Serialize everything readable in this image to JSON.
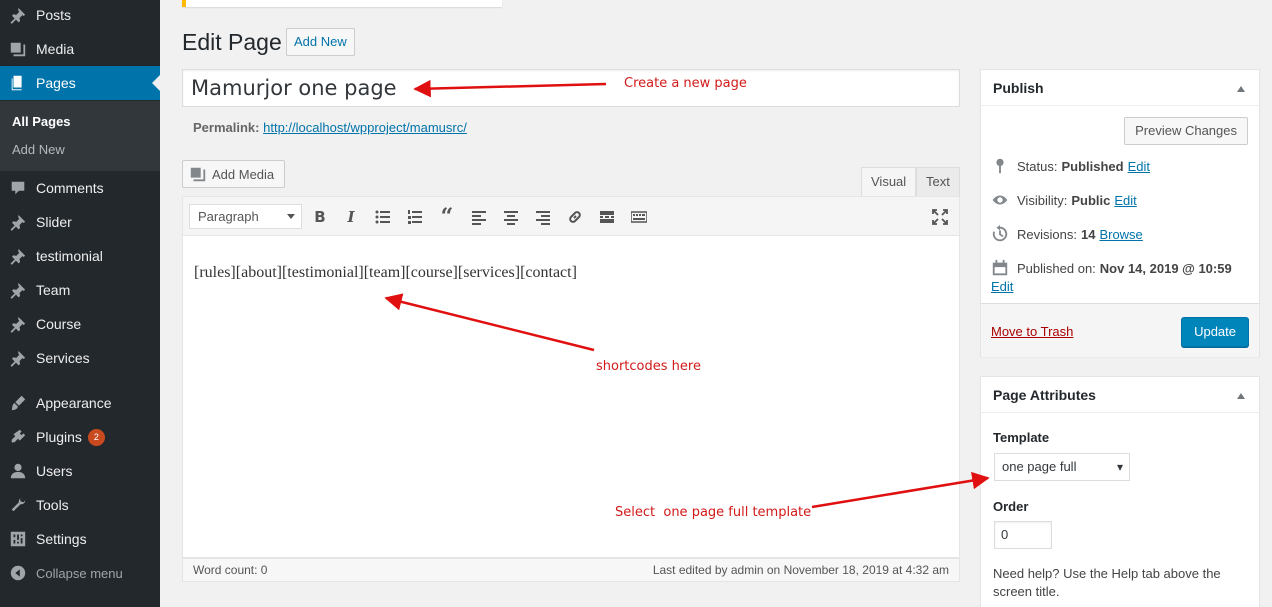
{
  "sidebar": {
    "items": [
      {
        "label": "Posts",
        "icon": "pin-icon"
      },
      {
        "label": "Media",
        "icon": "media-icon"
      },
      {
        "label": "Pages",
        "icon": "pages-icon",
        "active": true
      },
      {
        "label": "Comments",
        "icon": "comment-icon"
      },
      {
        "label": "Slider",
        "icon": "pin-icon"
      },
      {
        "label": "testimonial",
        "icon": "pin-icon"
      },
      {
        "label": "Team",
        "icon": "pin-icon"
      },
      {
        "label": "Course",
        "icon": "pin-icon"
      },
      {
        "label": "Services",
        "icon": "pin-icon"
      },
      {
        "label": "Appearance",
        "icon": "brush-icon"
      },
      {
        "label": "Plugins",
        "icon": "plugin-icon",
        "badge": "2"
      },
      {
        "label": "Users",
        "icon": "user-icon"
      },
      {
        "label": "Tools",
        "icon": "wrench-icon"
      },
      {
        "label": "Settings",
        "icon": "settings-icon"
      }
    ],
    "submenu": [
      "All Pages",
      "Add New"
    ],
    "collapse_label": "Collapse menu"
  },
  "page": {
    "heading": "Edit Page",
    "add_new_label": "Add New",
    "title_value": "Mamurjor one page",
    "permalink_label": "Permalink:",
    "permalink_url": "http://localhost/wpproject/mamusrc/"
  },
  "editor": {
    "add_media_label": "Add Media",
    "tab_visual": "Visual",
    "tab_text": "Text",
    "format_value": "Paragraph",
    "content": "[rules][about][testimonial][team][course][services][contact]",
    "word_count": "Word count: 0",
    "last_edited": "Last edited by admin on November 18, 2019 at 4:32 am"
  },
  "publish": {
    "title": "Publish",
    "preview_label": "Preview Changes",
    "status_label": "Status:",
    "status_value": "Published",
    "visibility_label": "Visibility:",
    "visibility_value": "Public",
    "revisions_label": "Revisions:",
    "revisions_value": "14",
    "browse_label": "Browse",
    "published_label": "Published on:",
    "published_value": "Nov 14, 2019 @ 10:59",
    "edit_label": "Edit",
    "trash_label": "Move to Trash",
    "update_label": "Update"
  },
  "attributes": {
    "title": "Page Attributes",
    "template_label": "Template",
    "template_value": "one page full",
    "order_label": "Order",
    "order_value": "0",
    "help_text": "Need help? Use the Help tab above the screen title."
  },
  "annotations": {
    "create_page": "Create a new page",
    "shortcodes": "shortcodes here",
    "select_template": "Select  one page full template"
  },
  "colors": {
    "sidebar_bg": "#23282d",
    "active_menu": "#0073aa",
    "annotation": "#d31a1a",
    "primary_button": "#0085ba"
  }
}
